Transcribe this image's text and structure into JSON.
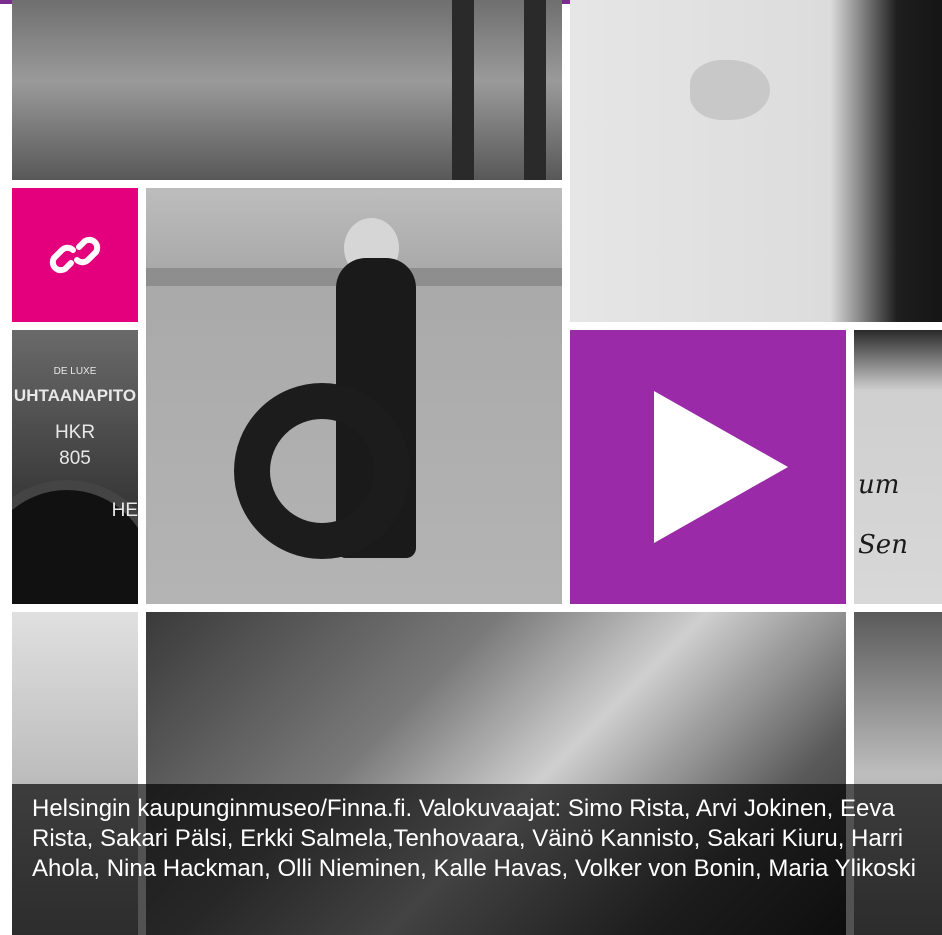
{
  "tiles": {
    "link": {
      "icon": "link-icon",
      "color": "#e4007c"
    },
    "play": {
      "icon": "play-icon",
      "color": "#9a2aa8"
    },
    "bus": {
      "line1": "UHTAANAPITO",
      "line2": "HKR",
      "line3": "805",
      "line4": "HE",
      "badge": "DE LUXE"
    },
    "signature": {
      "line1": "um",
      "line2": "Sen"
    }
  },
  "caption": {
    "text": "Helsingin kaupunginmuseo/Finna.fi. Valokuvaajat: Simo Rista, Arvi Jokinen, Eeva Rista, Sakari Pälsi, Erkki Salmela,Tenhovaara, Väinö Kannisto, Sakari Kiuru, Harri Ahola, Nina Hackman, Olli Nieminen, Kalle Havas, Volker von Bonin, Maria Ylikoski"
  },
  "colors": {
    "accent_top": "#7b2d8e",
    "caption_bg": "rgba(0,0,0,0.68)"
  }
}
